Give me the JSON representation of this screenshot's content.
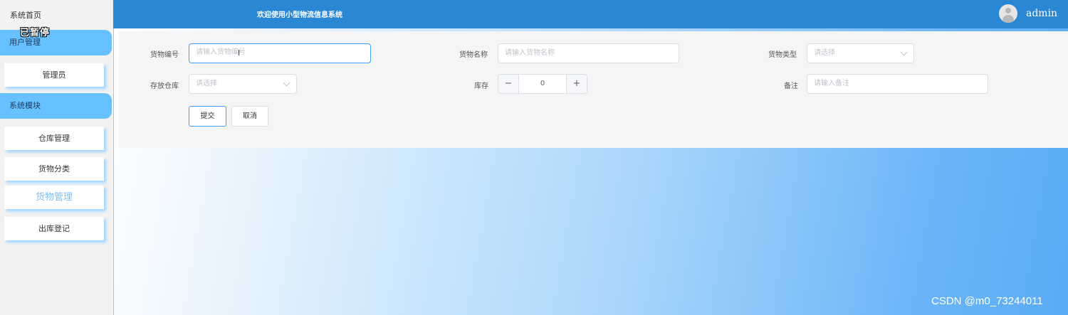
{
  "sidebar": {
    "home": "系统首页",
    "overlay": "已暂停",
    "groups": [
      {
        "label": "用户管理",
        "items": [
          {
            "label": "管理员"
          }
        ]
      },
      {
        "label": "系统模块",
        "items": [
          {
            "label": "仓库管理"
          },
          {
            "label": "货物分类"
          },
          {
            "label": "货物管理"
          },
          {
            "label": "出库登记"
          }
        ]
      }
    ]
  },
  "header": {
    "title": "欢迎使用小型物流信息系统",
    "username": "admin"
  },
  "form": {
    "code": {
      "label": "货物编号",
      "placeholder": "请输入货物编号"
    },
    "name": {
      "label": "货物名称",
      "placeholder": "请输入货物名称"
    },
    "type": {
      "label": "货物类型",
      "placeholder": "请选择"
    },
    "warehouse": {
      "label": "存放仓库",
      "placeholder": "请选择"
    },
    "stock": {
      "label": "库存",
      "value": "0",
      "minus": "−",
      "plus": "+"
    },
    "remark": {
      "label": "备注",
      "placeholder": "请输入备注"
    },
    "submit_label": "提交",
    "cancel_label": "取消"
  },
  "watermark": "CSDN @m0_73244011",
  "colors": {
    "header": "#2a87d4",
    "sidebar_group": "#67c1ff",
    "focus": "#409eff"
  }
}
